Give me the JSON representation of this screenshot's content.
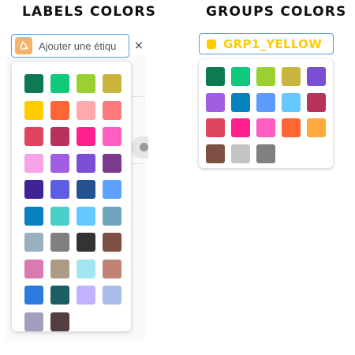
{
  "labels_section": {
    "title": "LABELS COLORS",
    "input_placeholder": "Ajouter une étiqu",
    "icon": "paint-drop-icon",
    "clear_label": "×",
    "colors": [
      "#0d7a52",
      "#10c97d",
      "#9bd032",
      "#c9b53d",
      "#ffcc00",
      "#ff6633",
      "#ffaaaa",
      "#ff7b7b",
      "#e0455f",
      "#b8325a",
      "#ff1f8e",
      "#ff5fc2",
      "#f8a3e6",
      "#a25ee3",
      "#7a4fd3",
      "#7b3b8f",
      "#3f2394",
      "#5e5de3",
      "#24518f",
      "#5ea1ff",
      "#0782c0",
      "#4ccfc6",
      "#65c8ff",
      "#6fa6bf",
      "#9bb0be",
      "#808080",
      "#333333",
      "#7e4f43",
      "#d97ab1",
      "#ad9b83",
      "#a3e5f3",
      "#c28275",
      "#2e7be0",
      "#1b5e63",
      "#c1b1ff",
      "#a9bdea",
      "#a29fbd",
      "#533f3f"
    ]
  },
  "groups_section": {
    "title": "GROUPS COLORS",
    "selected_value": "GRP1_YELLOW",
    "selected_color": "#ffcc00",
    "colors": [
      "#0d7a52",
      "#10c97d",
      "#9bd032",
      "#c9b53d",
      "#7a4fd3",
      "#a25ee3",
      "#0782c0",
      "#5e9bff",
      "#65c8ff",
      "#b8325a",
      "#e0455f",
      "#ff1f8e",
      "#ff5fc2",
      "#ff6633",
      "#ffaa3c",
      "#7e4f43",
      "#c4c4c4",
      "#808080"
    ]
  }
}
